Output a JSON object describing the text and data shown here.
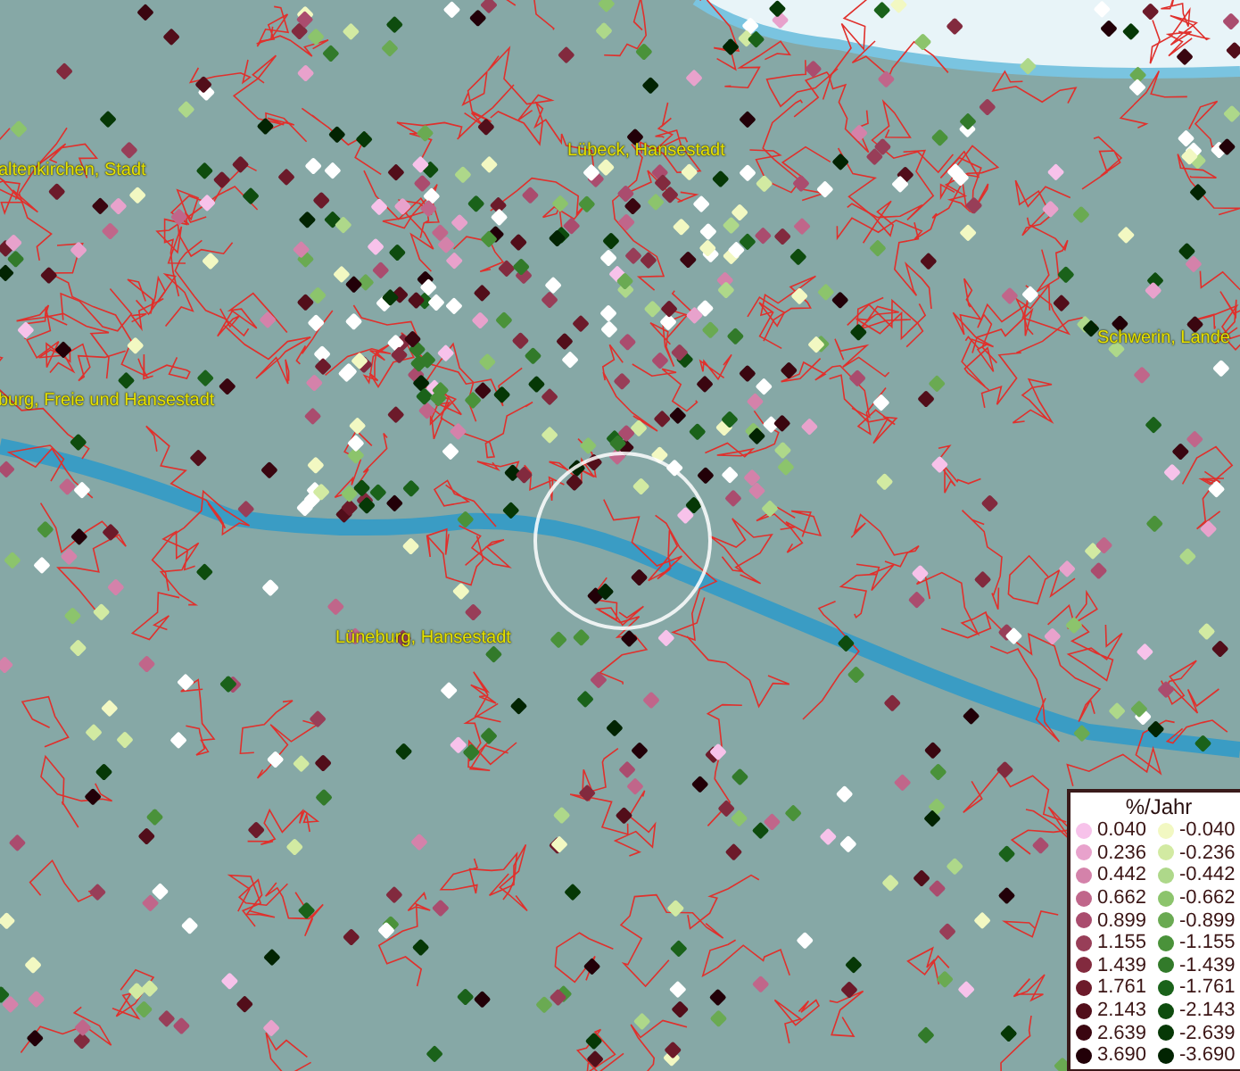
{
  "map": {
    "place_labels": [
      {
        "text": "altenkirchen, Stadt"
      },
      {
        "text": "Lübeck, Hansestadt"
      },
      {
        "text": "burg, Freie und Hansestadt"
      },
      {
        "text": "Schwerin, Lande"
      },
      {
        "text": "Lüneburg, Hansestadt"
      }
    ]
  },
  "legend": {
    "title": "%/Jahr",
    "rows": [
      {
        "positive": {
          "value": "0.040",
          "color": "#f7c2ea"
        },
        "negative": {
          "value": "-0.040",
          "color": "#f2f8c2"
        }
      },
      {
        "positive": {
          "value": "0.236",
          "color": "#e8a2cc"
        },
        "negative": {
          "value": "-0.236",
          "color": "#d2eaa2"
        }
      },
      {
        "positive": {
          "value": "0.442",
          "color": "#d482aa"
        },
        "negative": {
          "value": "-0.442",
          "color": "#aed88a"
        }
      },
      {
        "positive": {
          "value": "0.662",
          "color": "#c0668a"
        },
        "negative": {
          "value": "-0.662",
          "color": "#8cc46c"
        }
      },
      {
        "positive": {
          "value": "0.899",
          "color": "#aa4c6e"
        },
        "negative": {
          "value": "-0.899",
          "color": "#6aaa52"
        }
      },
      {
        "positive": {
          "value": "1.155",
          "color": "#983e58"
        },
        "negative": {
          "value": "-1.155",
          "color": "#4a923a"
        }
      },
      {
        "positive": {
          "value": "1.439",
          "color": "#822a3e"
        },
        "negative": {
          "value": "-1.439",
          "color": "#327a2a"
        }
      },
      {
        "positive": {
          "value": "1.761",
          "color": "#6c1a2a"
        },
        "negative": {
          "value": "-1.761",
          "color": "#1a621a"
        }
      },
      {
        "positive": {
          "value": "2.143",
          "color": "#520e1a"
        },
        "negative": {
          "value": "-2.143",
          "color": "#0e4c0e"
        }
      },
      {
        "positive": {
          "value": "2.639",
          "color": "#3a0610"
        },
        "negative": {
          "value": "-2.639",
          "color": "#063806"
        }
      },
      {
        "positive": {
          "value": "3.690",
          "color": "#220008"
        },
        "negative": {
          "value": "-3.690",
          "color": "#022402"
        }
      }
    ]
  }
}
